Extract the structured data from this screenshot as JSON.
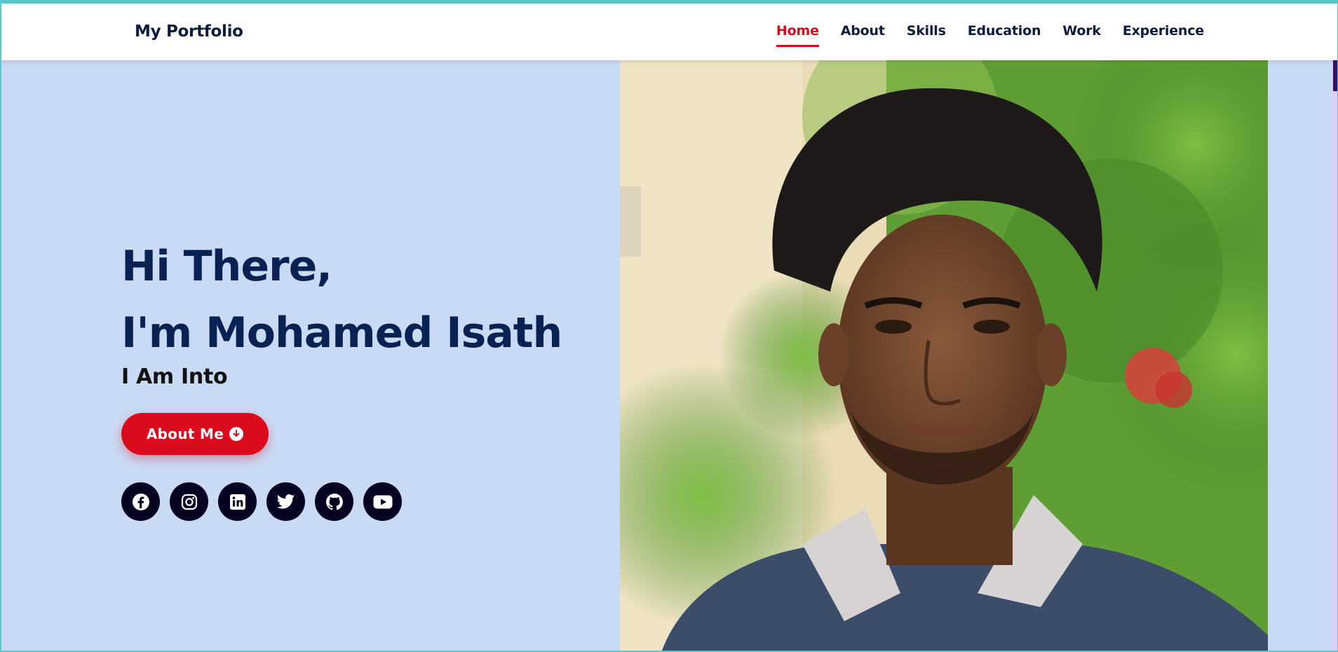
{
  "brand": "My Portfolio",
  "nav": {
    "items": [
      {
        "label": "Home",
        "active": true
      },
      {
        "label": "About",
        "active": false
      },
      {
        "label": "Skills",
        "active": false
      },
      {
        "label": "Education",
        "active": false
      },
      {
        "label": "Work",
        "active": false
      },
      {
        "label": "Experience",
        "active": false
      }
    ]
  },
  "hero": {
    "line1": "Hi There,",
    "line2": "I'm Mohamed Isath",
    "subtitle": "I Am Into",
    "button_label": "About Me"
  },
  "socials": [
    "facebook-icon",
    "instagram-icon",
    "linkedin-icon",
    "twitter-icon",
    "github-icon",
    "youtube-icon"
  ],
  "colors": {
    "accent": "#d90b1c",
    "heading": "#0a2253",
    "background": "#c9daf4",
    "social_bg": "#060221"
  }
}
